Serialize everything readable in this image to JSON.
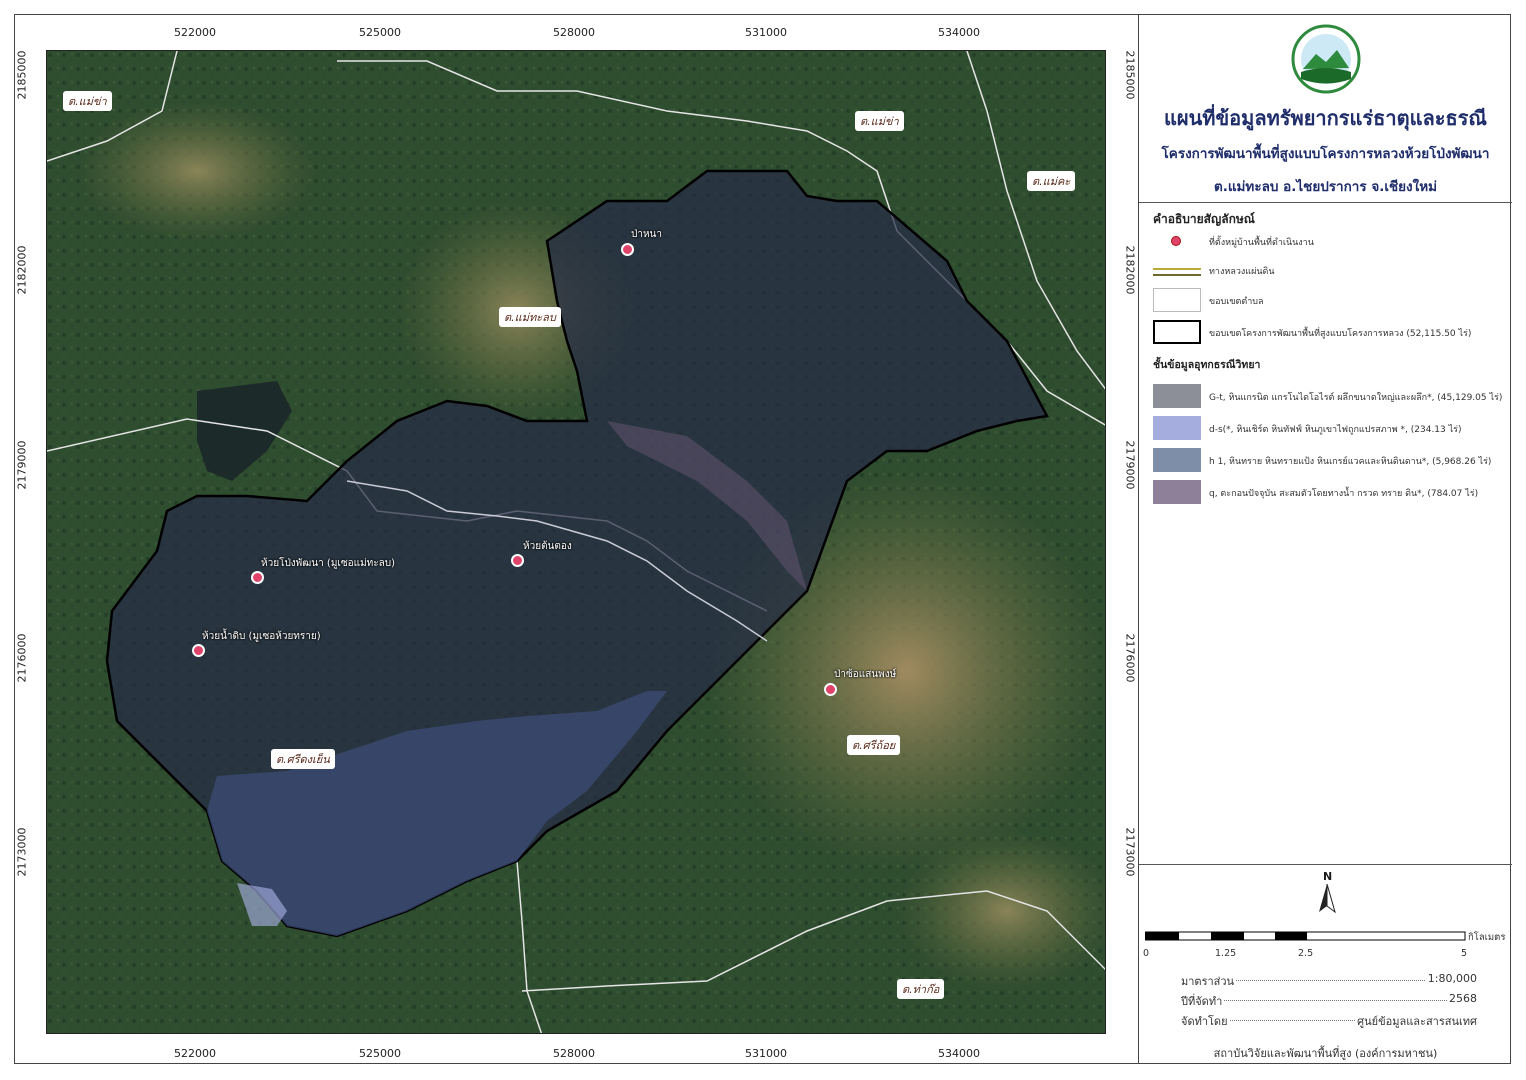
{
  "map": {
    "grid_x_labels": [
      "522000",
      "525000",
      "528000",
      "531000",
      "534000"
    ],
    "grid_y_labels": [
      "2185000",
      "2182000",
      "2179000",
      "2176000",
      "2173000"
    ],
    "villages": [
      {
        "name": "ป่าหนา"
      },
      {
        "name": "ห้วยต้นตอง"
      },
      {
        "name": "ห้วยโป่งพัฒนา (มูเซอแม่ทะลบ)"
      },
      {
        "name": "ห้วยน้ำดิบ (มูเซอห้วยทราย)"
      },
      {
        "name": "ป่าซ้อแสนพงษ์"
      }
    ],
    "subdistricts": [
      {
        "name": "ต.แม่ข่า"
      },
      {
        "name": "ต.แม่ข่า"
      },
      {
        "name": "ต.แม่คะ"
      },
      {
        "name": "ต.แม่ทะลบ"
      },
      {
        "name": "ต.ศรีดงเย็น"
      },
      {
        "name": "ต.ศรีถ้อย"
      },
      {
        "name": "ต.ท่าก๊อ"
      }
    ],
    "colors": {
      "forest_dark": "#1f3a24",
      "forest": "#3a5a35",
      "farmland": "#7a7a52",
      "project_fill": "#2b2f45",
      "geo_gt": "#8c8e98",
      "geo_ds": "#a5acde",
      "geo_h1": "#7f8ea8",
      "geo_q": "#8d8098",
      "village_marker": "#e0436a"
    }
  },
  "panel": {
    "title": "แผนที่ข้อมูลทรัพยากรแร่ธาตุและธรณี",
    "subtitle1": "โครงการพัฒนาพื้นที่สูงแบบโครงการหลวงห้วยโป่งพัฒนา",
    "subtitle2": "ต.แม่ทะลบ อ.ไชยปราการ จ.เชียงใหม่",
    "legend_title": "คำอธิบายสัญลักษณ์",
    "legend_items": [
      {
        "label": "ที่ตั้งหมู่บ้านพื้นที่ดำเนินงาน"
      },
      {
        "label": "ทางหลวงแผ่นดิน"
      },
      {
        "label": "ขอบเขตตำบล"
      },
      {
        "label": "ขอบเขตโครงการพัฒนาพื้นที่สูงแบบโครงการหลวง (52,115.50 ไร่)"
      }
    ],
    "geo_title": "ชั้นข้อมูลอุทกธรณีวิทยา",
    "geo_items": [
      {
        "label": "G-t, หินแกรนิต แกรโนไดโอไรต์ ผลึกขนาดใหญ่และผลึก*, (45,129.05 ไร่)"
      },
      {
        "label": "d-s(*, หินเชิร์ต หินทัฟฟ์ หินภูเขาไฟถูกแปรสภาพ *, (234.13 ไร่)"
      },
      {
        "label": "h 1, หินทราย หินทรายแป้ง หินเกรย์แวคและหินดินดาน*, (5,968.26 ไร่)"
      },
      {
        "label": "q, ตะกอนปัจจุบัน สะสมตัวโดยทางน้ำ กรวด ทราย ดิน*, (784.07 ไร่)"
      }
    ],
    "north": "N",
    "scale": {
      "unit": "กิโลเมตร",
      "ticks": [
        "0",
        "1.25",
        "2.5",
        "5"
      ]
    },
    "info": [
      {
        "key": "มาตราส่วน",
        "value": "1:80,000"
      },
      {
        "key": "ปีที่จัดทำ",
        "value": "2568"
      },
      {
        "key": "จัดทำโดย",
        "value": "ศูนย์ข้อมูลและสารสนเทศ"
      }
    ],
    "footer": "สถาบันวิจัยและพัฒนาพื้นที่สูง (องค์การมหาชน)"
  }
}
